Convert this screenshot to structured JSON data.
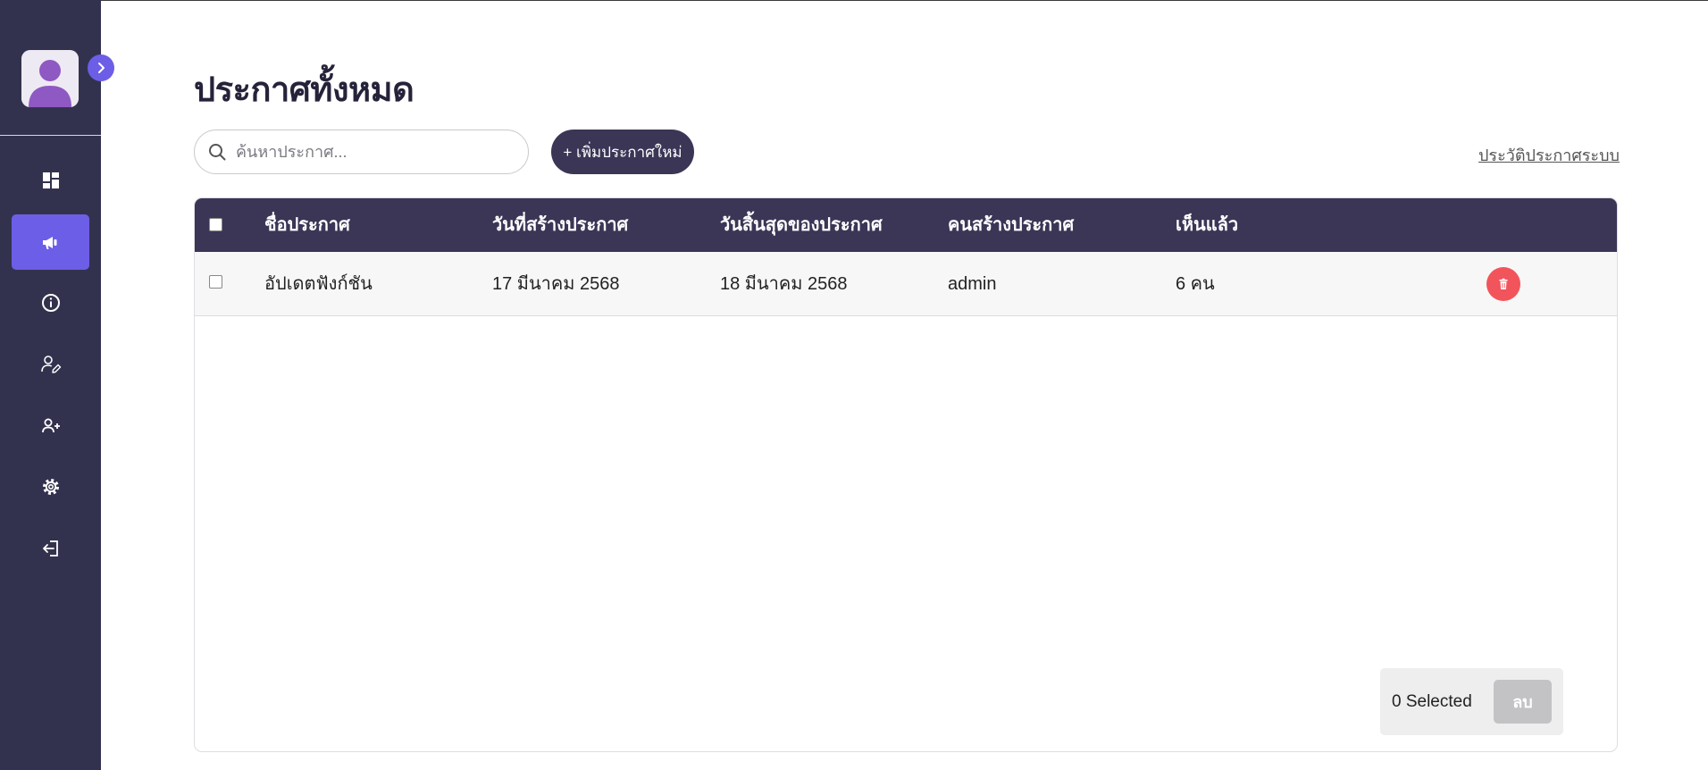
{
  "page": {
    "title": "ประกาศทั้งหมด"
  },
  "toolbar": {
    "search_placeholder": "ค้นหาประกาศ...",
    "search_value": "",
    "add_label": "+ เพิ่มประกาศใหม่",
    "history_label": "ประวัติประกาศระบบ"
  },
  "sidebar": {
    "items": [
      {
        "icon": "dashboard-icon",
        "active": false
      },
      {
        "icon": "megaphone-icon",
        "active": true
      },
      {
        "icon": "info-icon",
        "active": false
      },
      {
        "icon": "user-edit-icon",
        "active": false
      },
      {
        "icon": "user-add-icon",
        "active": false
      },
      {
        "icon": "gear-icon",
        "active": false
      },
      {
        "icon": "logout-icon",
        "active": false
      }
    ]
  },
  "table": {
    "columns": [
      "ชื่อประกาศ",
      "วันที่สร้างประกาศ",
      "วันสิ้นสุดของประกาศ",
      "คนสร้างประกาศ",
      "เห็นแล้ว"
    ],
    "rows": [
      {
        "name": "อัปเดตฟังก์ชัน",
        "created": "17 มีนาคม 2568",
        "ends": "18 มีนาคม 2568",
        "creator": "admin",
        "seen": "6 คน"
      }
    ]
  },
  "footer": {
    "selected_label": "0 Selected",
    "delete_label": "ลบ"
  },
  "colors": {
    "sidebar": "#33324e",
    "accent": "#6c5ee6",
    "header": "#3b3556",
    "danger": "#f2545b"
  }
}
